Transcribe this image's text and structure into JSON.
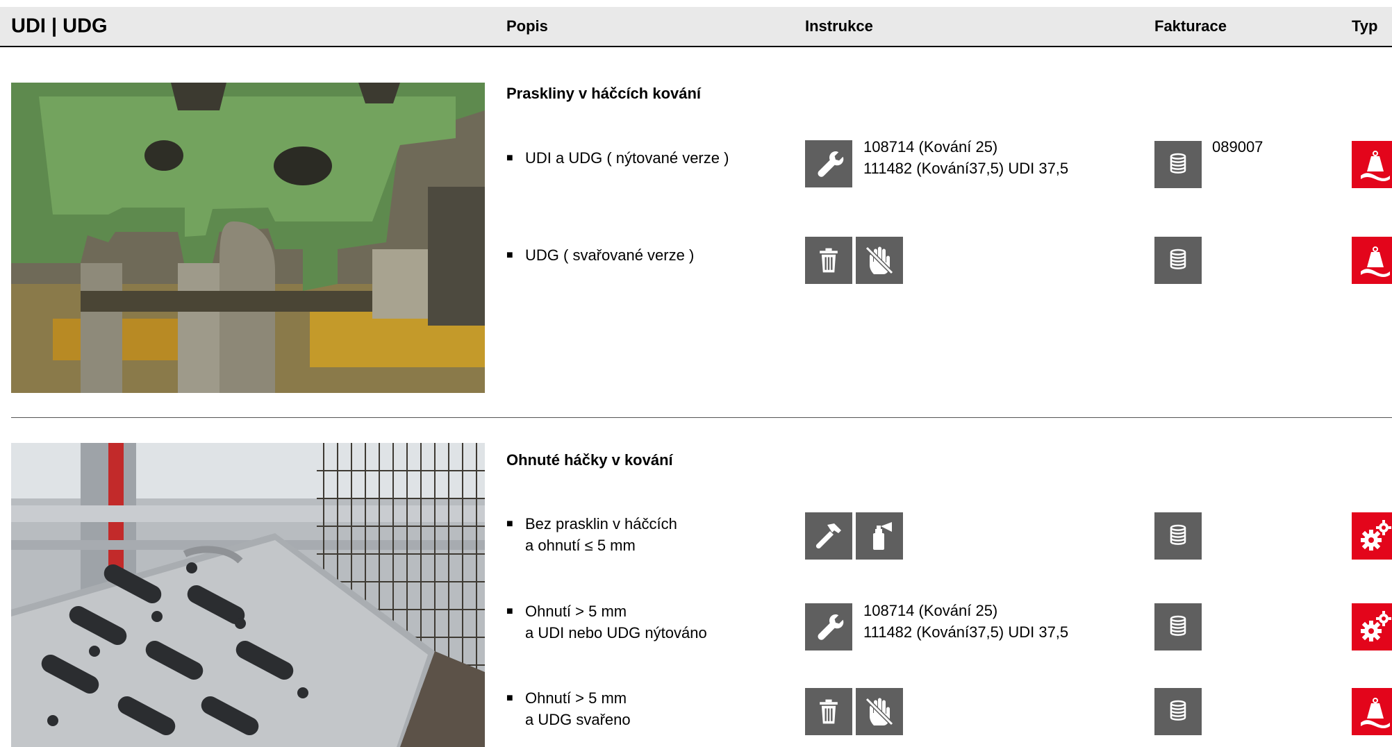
{
  "header": {
    "title": "UDI | UDG",
    "col_popis": "Popis",
    "col_instrukce": "Instrukce",
    "col_fakturace": "Fakturace",
    "col_typ": "Typ"
  },
  "sections": [
    {
      "title": "Praskliny v háčcích kování",
      "rows": [
        {
          "bullet": "■",
          "lines": [
            "UDI a UDG ( nýtované verze )"
          ],
          "instr_icons": [
            "wrench-icon"
          ],
          "refs": [
            "108714 (Kování 25)",
            "111482 (Kování37,5) UDI 37,5"
          ],
          "fakt_icon": "coin-stack-icon",
          "fakt_code": "089007",
          "typ_icon": "weight-kg-icon"
        },
        {
          "bullet": "■",
          "lines": [
            "UDG ( svařované verze )"
          ],
          "instr_icons": [
            "trash-icon",
            "no-touch-hand-icon"
          ],
          "fakt_icon": "coin-stack-icon",
          "typ_icon": "weight-kg-icon"
        }
      ]
    },
    {
      "title": "Ohnuté háčky v kování",
      "rows": [
        {
          "bullet": "■",
          "lines": [
            "Bez prasklin v háčcích",
            "a ohnutí ≤ 5 mm"
          ],
          "instr_icons": [
            "hammer-icon",
            "spray-can-icon"
          ],
          "fakt_icon": "coin-stack-icon",
          "typ_icon": "gears-icon"
        },
        {
          "bullet": "■",
          "lines": [
            "Ohnutí  > 5 mm",
            "a UDI nebo UDG nýtováno"
          ],
          "instr_icons": [
            "wrench-icon"
          ],
          "refs": [
            "108714 (Kování 25)",
            "111482 (Kování37,5) UDI 37,5"
          ],
          "fakt_icon": "coin-stack-icon",
          "typ_icon": "gears-icon"
        },
        {
          "bullet": "■",
          "lines": [
            "Ohnutí > 5 mm",
            "a UDG svařeno"
          ],
          "instr_icons": [
            "trash-icon",
            "no-touch-hand-icon"
          ],
          "fakt_icon": "coin-stack-icon",
          "typ_icon": "weight-kg-icon"
        }
      ]
    }
  ],
  "colors": {
    "header_bg": "#e9e9e9",
    "icon_gray": "#5f5f5f",
    "type_red": "#e3051b"
  },
  "photos": [
    "cracked-hook-fitting-photo",
    "bent-hook-platform-photo"
  ],
  "weight_label": "kg"
}
